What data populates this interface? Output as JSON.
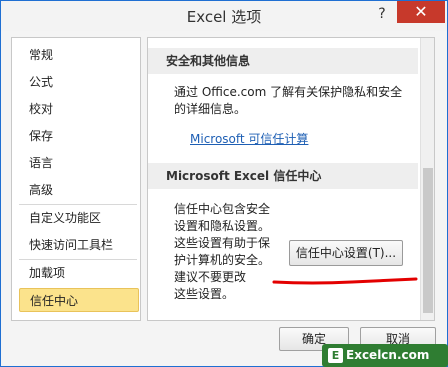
{
  "window": {
    "title": "Excel 选项",
    "help_label": "?",
    "close_label": "✕"
  },
  "nav": {
    "items": [
      {
        "label": "常规"
      },
      {
        "label": "公式"
      },
      {
        "label": "校对"
      },
      {
        "label": "保存"
      },
      {
        "label": "语言"
      },
      {
        "label": "高级"
      },
      {
        "label": "自定义功能区"
      },
      {
        "label": "快速访问工具栏"
      },
      {
        "label": "加载项"
      },
      {
        "label": "信任中心",
        "selected": true
      }
    ]
  },
  "content": {
    "privacy_section": {
      "heading": "安全和其他信息",
      "text_line1": "通过 Office.com 了解有关保护隐私和安全",
      "text_line2": "的详细信息。",
      "link": "Microsoft 可信任计算"
    },
    "trust_section": {
      "heading": "Microsoft Excel 信任中心",
      "lines": [
        "信任中心包含安全",
        "设置和隐私设置。",
        "这些设置有助于保",
        "护计算机的安全。",
        "建议不要更改",
        "这些设置。"
      ],
      "button_label": "信任中心设置(T)..."
    }
  },
  "footer": {
    "ok_label": "确定",
    "cancel_label": "取消"
  },
  "watermark": {
    "icon": "E",
    "text": "Excelcn.com"
  },
  "colors": {
    "accent": "#1f6fd2",
    "selected_bg": "#fbe38c",
    "close_red": "#c7392b",
    "link": "#1e5fb4",
    "annotation_red": "#e30000"
  }
}
